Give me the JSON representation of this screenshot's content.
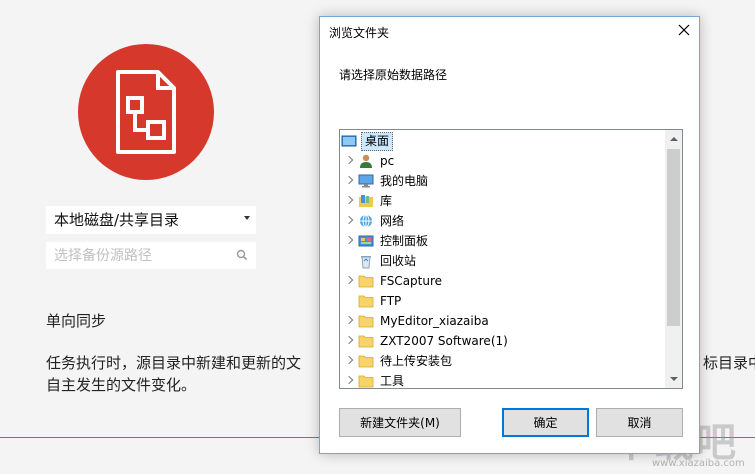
{
  "background": {
    "source_select": {
      "value": "本地磁盘/共享目录"
    },
    "path_input": {
      "placeholder": "选择备份源路径"
    },
    "sync_mode": "单向同步",
    "description_line1": "任务执行时，源目录中新建和更新的文",
    "description_line1_tail": "标目录中",
    "description_line2": "自主发生的文件变化。",
    "watermark": "下载吧",
    "watermark_url": "www.xiazaiba.com",
    "accent_color": "#d6382c"
  },
  "dialog": {
    "title": "浏览文件夹",
    "prompt": "请选择原始数据路径",
    "tree": [
      {
        "label": "桌面",
        "icon": "desktop-icon",
        "level": 0,
        "expandable": false,
        "selected": true
      },
      {
        "label": "pc",
        "icon": "user-icon",
        "level": 1,
        "expandable": true
      },
      {
        "label": "我的电脑",
        "icon": "computer-icon",
        "level": 1,
        "expandable": true
      },
      {
        "label": "库",
        "icon": "library-icon",
        "level": 1,
        "expandable": true
      },
      {
        "label": "网络",
        "icon": "network-icon",
        "level": 1,
        "expandable": true
      },
      {
        "label": "控制面板",
        "icon": "control-panel-icon",
        "level": 1,
        "expandable": true
      },
      {
        "label": "回收站",
        "icon": "recycle-bin-icon",
        "level": 1,
        "expandable": false
      },
      {
        "label": "FSCapture",
        "icon": "folder-icon",
        "level": 1,
        "expandable": true
      },
      {
        "label": "FTP",
        "icon": "folder-icon",
        "level": 1,
        "expandable": false
      },
      {
        "label": "MyEditor_xiazaiba",
        "icon": "folder-icon",
        "level": 1,
        "expandable": true
      },
      {
        "label": "ZXT2007 Software(1)",
        "icon": "folder-icon",
        "level": 1,
        "expandable": true
      },
      {
        "label": "待上传安装包",
        "icon": "folder-icon",
        "level": 1,
        "expandable": true
      },
      {
        "label": "工具",
        "icon": "folder-icon",
        "level": 1,
        "expandable": true
      }
    ],
    "buttons": {
      "new_folder": "新建文件夹(M)",
      "ok": "确定",
      "cancel": "取消"
    }
  }
}
